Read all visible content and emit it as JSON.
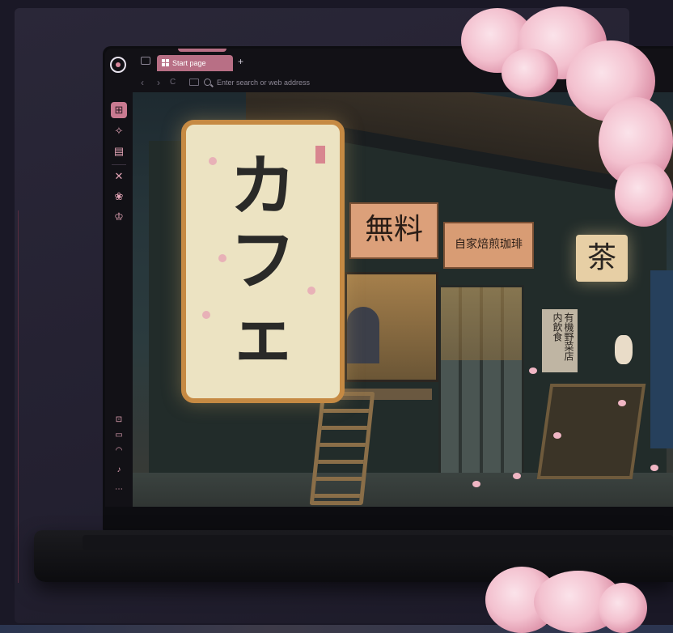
{
  "browser": {
    "tab": {
      "label": "Start page"
    },
    "new_tab_label": "+",
    "address": {
      "placeholder": "Enter search or web address"
    },
    "nav": {
      "back": "‹",
      "forward": "›",
      "reload": "C"
    }
  },
  "sidebar": {
    "items": [
      {
        "name": "panels",
        "glyph": "⊞"
      },
      {
        "name": "cloud-sync",
        "glyph": "✧"
      },
      {
        "name": "reading-list",
        "glyph": "▤"
      },
      {
        "name": "close",
        "glyph": "✕"
      },
      {
        "name": "flower",
        "glyph": "❀"
      },
      {
        "name": "crown",
        "glyph": "♔"
      }
    ],
    "bottom": [
      {
        "name": "settings",
        "glyph": "⊡"
      },
      {
        "name": "window",
        "glyph": "▭"
      },
      {
        "name": "wifi",
        "glyph": "◠"
      },
      {
        "name": "music",
        "glyph": "♪"
      },
      {
        "name": "more",
        "glyph": "⋯"
      }
    ]
  },
  "scene": {
    "cafe_sign": "カフェ",
    "free_sign": "無料",
    "coffee_sign": "自家焙煎珈琲",
    "tea_sign": "茶",
    "menu_board": "有機野菜店内飲食"
  },
  "colors": {
    "accent": "#b86f85",
    "background": "#1a1826"
  }
}
